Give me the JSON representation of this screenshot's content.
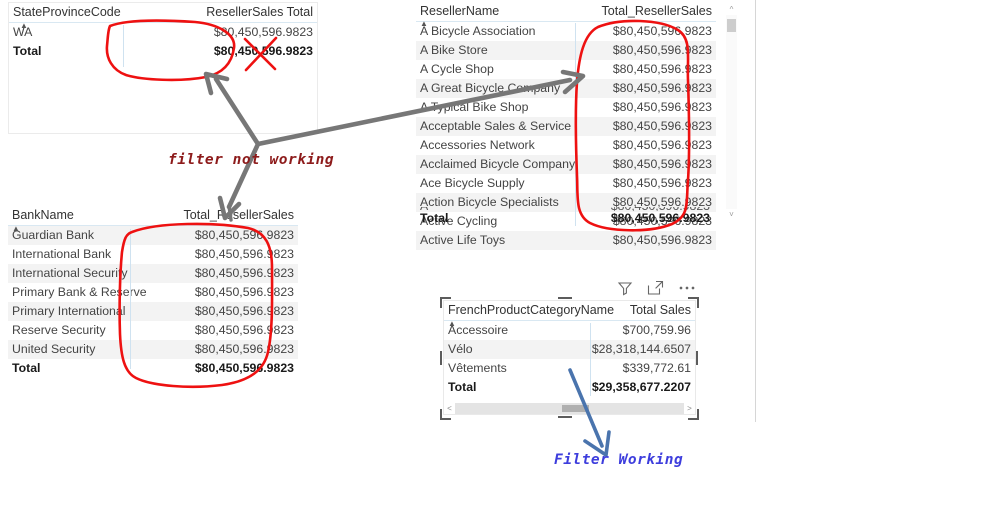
{
  "colors": {
    "annotation_red": "#8d1b1b",
    "circle_red": "#ee1111",
    "annotation_blue": "#3d3ddd",
    "arrow_gray": "#777777",
    "arrow_blue": "#4a74ad",
    "row_stripe": "#f3f3f3",
    "header_rule": "#d9e8f2"
  },
  "annotations": {
    "filter_not_working": "filter not working",
    "filter_working": "Filter Working"
  },
  "visuals": {
    "state_province": {
      "name": "StateProvinceCode table",
      "columns": [
        "StateProvinceCode",
        "ResellerSales Total"
      ],
      "rows": [
        {
          "label": "WA",
          "value": "$80,450,596.9823"
        }
      ],
      "total": {
        "label": "Total",
        "value": "$80,450,596.9823"
      }
    },
    "reseller_name": {
      "name": "ResellerName table",
      "columns": [
        "ResellerName",
        "Total_ResellerSales"
      ],
      "rows": [
        {
          "label": "A Bicycle Association",
          "value": "$80,450,596.9823"
        },
        {
          "label": "A Bike Store",
          "value": "$80,450,596.9823"
        },
        {
          "label": "A Cycle Shop",
          "value": "$80,450,596.9823"
        },
        {
          "label": "A Great Bicycle Company",
          "value": "$80,450,596.9823"
        },
        {
          "label": "A Typical Bike Shop",
          "value": "$80,450,596.9823"
        },
        {
          "label": "Acceptable Sales & Service",
          "value": "$80,450,596.9823"
        },
        {
          "label": "Accessories Network",
          "value": "$80,450,596.9823"
        },
        {
          "label": "Acclaimed Bicycle Company",
          "value": "$80,450,596.9823"
        },
        {
          "label": "Ace Bicycle Supply",
          "value": "$80,450,596.9823"
        },
        {
          "label": "Action Bicycle Specialists",
          "value": "$80,450,596.9823"
        },
        {
          "label": "Active Cycling",
          "value": "$80,450,596.9823"
        },
        {
          "label": "Active Life Toys",
          "value": "$80,450,596.9823"
        }
      ],
      "total": {
        "label": "Total",
        "value": "$80,450,596.9823"
      }
    },
    "bank_name": {
      "name": "BankName table",
      "columns": [
        "BankName",
        "Total_ResellerSales"
      ],
      "rows": [
        {
          "label": "Guardian Bank",
          "value": "$80,450,596.9823"
        },
        {
          "label": "International Bank",
          "value": "$80,450,596.9823"
        },
        {
          "label": "International Security",
          "value": "$80,450,596.9823"
        },
        {
          "label": "Primary Bank & Reserve",
          "value": "$80,450,596.9823"
        },
        {
          "label": "Primary International",
          "value": "$80,450,596.9823"
        },
        {
          "label": "Reserve Security",
          "value": "$80,450,596.9823"
        },
        {
          "label": "United Security",
          "value": "$80,450,596.9823"
        }
      ],
      "total": {
        "label": "Total",
        "value": "$80,450,596.9823"
      }
    },
    "french_category": {
      "name": "FrenchProductCategoryName table",
      "columns": [
        "FrenchProductCategoryName",
        "Total Sales"
      ],
      "rows": [
        {
          "label": "Accessoire",
          "value": "$700,759.96"
        },
        {
          "label": "Vélo",
          "value": "$28,318,144.6507"
        },
        {
          "label": "Vêtements",
          "value": "$339,772.61"
        }
      ],
      "total": {
        "label": "Total",
        "value": "$29,358,677.2207"
      },
      "icons": [
        {
          "id": "filter-icon",
          "label": "Filters"
        },
        {
          "id": "focus-mode-icon",
          "label": "Focus mode"
        },
        {
          "id": "more-options-icon",
          "label": "More options"
        }
      ]
    }
  }
}
